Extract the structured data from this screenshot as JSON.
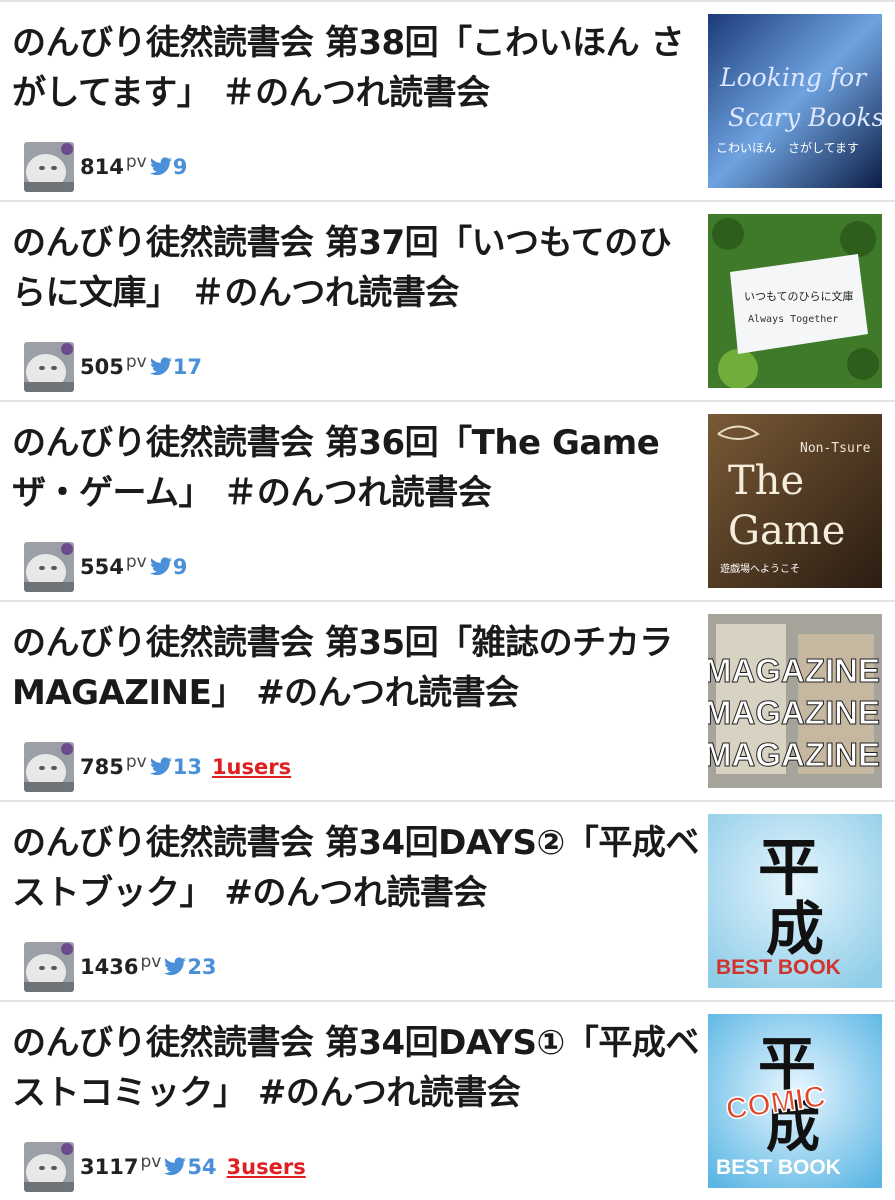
{
  "articles": [
    {
      "title": "のんびり徒然読書会 第38回「こわいほん さがしてます」 ＃のんつれ読書会",
      "pv": "814",
      "pv_unit": "pv",
      "tweets": "9",
      "users": "",
      "thumb": {
        "line1": "Looking for",
        "line2": "Scary Books",
        "sub": "こわいほん　さがしてます"
      }
    },
    {
      "title": "のんびり徒然読書会 第37回「いつもてのひらに文庫」 ＃のんつれ読書会",
      "pv": "505",
      "pv_unit": "pv",
      "tweets": "17",
      "users": "",
      "thumb": {
        "line1": "いつもてのひらに文庫",
        "line2": "Always Together"
      }
    },
    {
      "title": "のんびり徒然読書会 第36回「The Game ザ・ゲーム」 ＃のんつれ読書会",
      "pv": "554",
      "pv_unit": "pv",
      "tweets": "9",
      "users": "",
      "thumb": {
        "top": "Non-Tsure",
        "line1": "The",
        "line2": "Game",
        "sub": "遊戯場へようこそ"
      }
    },
    {
      "title": "のんびり徒然読書会 第35回「雑誌のチカラ MAGAZINE」 #のんつれ読書会",
      "pv": "785",
      "pv_unit": "pv",
      "tweets": "13",
      "users": "1users",
      "thumb": {
        "line1": "MAGAZINE",
        "line2": "MAGAZINE",
        "line3": "MAGAZINE"
      }
    },
    {
      "title": "のんびり徒然読書会 第34回DAYS②「平成ベストブック」 #のんつれ読書会",
      "pv": "1436",
      "pv_unit": "pv",
      "tweets": "23",
      "users": "",
      "thumb": {
        "kanji1": "平",
        "kanji2": "成",
        "sub": "BEST BOOK"
      }
    },
    {
      "title": "のんびり徒然読書会 第34回DAYS①「平成ベストコミック」 #のんつれ読書会",
      "pv": "3117",
      "pv_unit": "pv",
      "tweets": "54",
      "users": "3users",
      "thumb": {
        "kanji1": "平",
        "kanji2": "成",
        "badge": "COMIC",
        "sub": "BEST BOOK"
      }
    }
  ],
  "colors": {
    "tweet": "#4a90d9",
    "users": "#e02020",
    "divider": "#e3e3e3"
  }
}
